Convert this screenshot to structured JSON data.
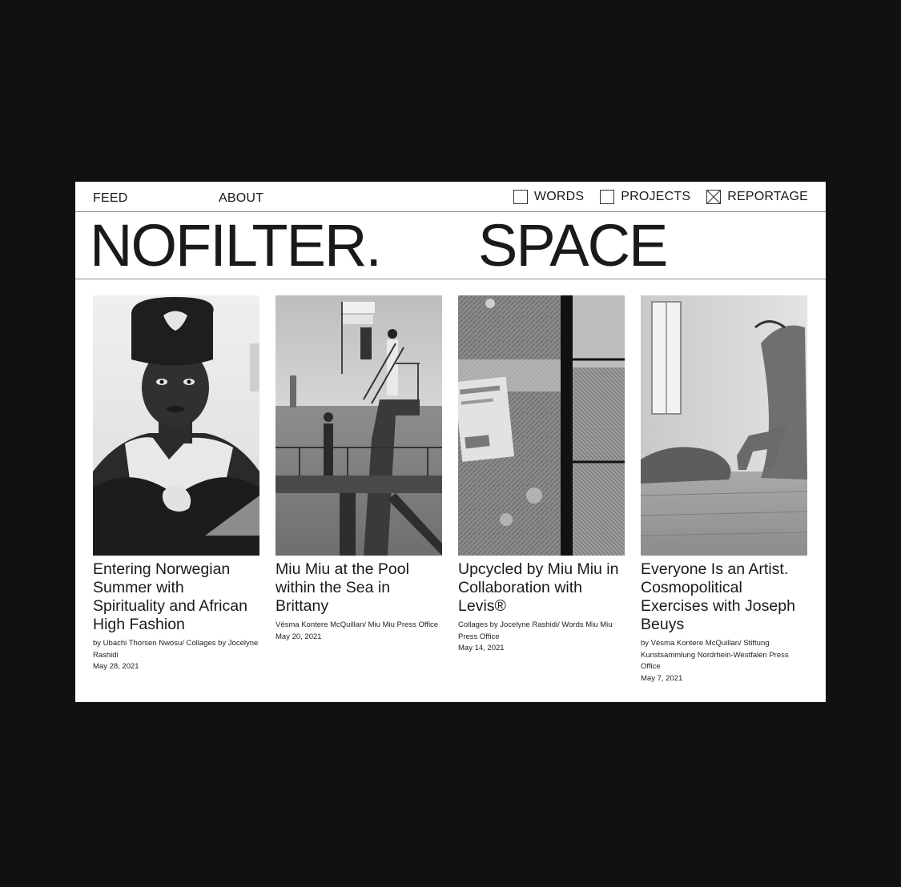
{
  "nav": {
    "feed": "FEED",
    "about": "ABOUT"
  },
  "filters": [
    {
      "label": "WORDS",
      "checked": false
    },
    {
      "label": "PROJECTS",
      "checked": false
    },
    {
      "label": "REPORTAGE",
      "checked": true
    }
  ],
  "brand": {
    "left": "NOFILTER.",
    "right": "SPACE"
  },
  "articles": [
    {
      "title": "Entering Norwegian Summer with Spirituality and African High Fashion",
      "credit": "by Ubachi Thorsen Nwosu/ Collages by Jocelyne Rashidi",
      "date": "May 28, 2021"
    },
    {
      "title": "Miu Miu at the Pool within the Sea in Brittany",
      "credit": "Vésma Kontere McQuillan/ Miu Miu Press Office",
      "date": "May 20, 2021"
    },
    {
      "title": "Upcycled by Miu Miu in Collaboration with Levis®",
      "credit": "Collages by Jocelyne Rashidi/ Words Miu Miu Press Office",
      "date": "May 14, 2021"
    },
    {
      "title": "Everyone Is an Artist. Cosmopolitical Exercises with Joseph Beuys",
      "credit": "by Vésma Kontere McQuillan/ Stiftung Kunstsammlung Nordrhein-Westfalen Press Office",
      "date": "May 7, 2021"
    }
  ],
  "colors": {
    "backdrop": "#111111",
    "page": "#ffffff",
    "text": "#1a1a1a",
    "rule": "#8a8a8a"
  }
}
